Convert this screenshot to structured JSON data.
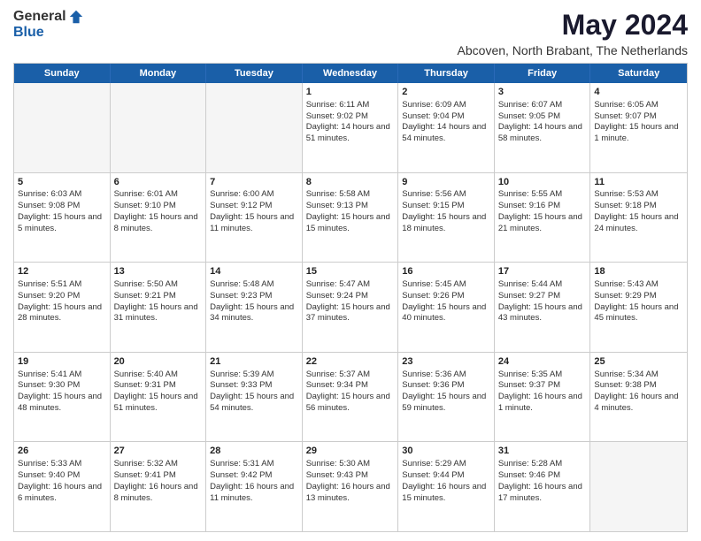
{
  "logo": {
    "general": "General",
    "blue": "Blue"
  },
  "title": "May 2024",
  "location": "Abcoven, North Brabant, The Netherlands",
  "header_days": [
    "Sunday",
    "Monday",
    "Tuesday",
    "Wednesday",
    "Thursday",
    "Friday",
    "Saturday"
  ],
  "weeks": [
    [
      {
        "day": "",
        "info": "",
        "empty": true
      },
      {
        "day": "",
        "info": "",
        "empty": true
      },
      {
        "day": "",
        "info": "",
        "empty": true
      },
      {
        "day": "1",
        "sunrise": "Sunrise: 6:11 AM",
        "sunset": "Sunset: 9:02 PM",
        "daylight": "Daylight: 14 hours and 51 minutes."
      },
      {
        "day": "2",
        "sunrise": "Sunrise: 6:09 AM",
        "sunset": "Sunset: 9:04 PM",
        "daylight": "Daylight: 14 hours and 54 minutes."
      },
      {
        "day": "3",
        "sunrise": "Sunrise: 6:07 AM",
        "sunset": "Sunset: 9:05 PM",
        "daylight": "Daylight: 14 hours and 58 minutes."
      },
      {
        "day": "4",
        "sunrise": "Sunrise: 6:05 AM",
        "sunset": "Sunset: 9:07 PM",
        "daylight": "Daylight: 15 hours and 1 minute."
      }
    ],
    [
      {
        "day": "5",
        "sunrise": "Sunrise: 6:03 AM",
        "sunset": "Sunset: 9:08 PM",
        "daylight": "Daylight: 15 hours and 5 minutes."
      },
      {
        "day": "6",
        "sunrise": "Sunrise: 6:01 AM",
        "sunset": "Sunset: 9:10 PM",
        "daylight": "Daylight: 15 hours and 8 minutes."
      },
      {
        "day": "7",
        "sunrise": "Sunrise: 6:00 AM",
        "sunset": "Sunset: 9:12 PM",
        "daylight": "Daylight: 15 hours and 11 minutes."
      },
      {
        "day": "8",
        "sunrise": "Sunrise: 5:58 AM",
        "sunset": "Sunset: 9:13 PM",
        "daylight": "Daylight: 15 hours and 15 minutes."
      },
      {
        "day": "9",
        "sunrise": "Sunrise: 5:56 AM",
        "sunset": "Sunset: 9:15 PM",
        "daylight": "Daylight: 15 hours and 18 minutes."
      },
      {
        "day": "10",
        "sunrise": "Sunrise: 5:55 AM",
        "sunset": "Sunset: 9:16 PM",
        "daylight": "Daylight: 15 hours and 21 minutes."
      },
      {
        "day": "11",
        "sunrise": "Sunrise: 5:53 AM",
        "sunset": "Sunset: 9:18 PM",
        "daylight": "Daylight: 15 hours and 24 minutes."
      }
    ],
    [
      {
        "day": "12",
        "sunrise": "Sunrise: 5:51 AM",
        "sunset": "Sunset: 9:20 PM",
        "daylight": "Daylight: 15 hours and 28 minutes."
      },
      {
        "day": "13",
        "sunrise": "Sunrise: 5:50 AM",
        "sunset": "Sunset: 9:21 PM",
        "daylight": "Daylight: 15 hours and 31 minutes."
      },
      {
        "day": "14",
        "sunrise": "Sunrise: 5:48 AM",
        "sunset": "Sunset: 9:23 PM",
        "daylight": "Daylight: 15 hours and 34 minutes."
      },
      {
        "day": "15",
        "sunrise": "Sunrise: 5:47 AM",
        "sunset": "Sunset: 9:24 PM",
        "daylight": "Daylight: 15 hours and 37 minutes."
      },
      {
        "day": "16",
        "sunrise": "Sunrise: 5:45 AM",
        "sunset": "Sunset: 9:26 PM",
        "daylight": "Daylight: 15 hours and 40 minutes."
      },
      {
        "day": "17",
        "sunrise": "Sunrise: 5:44 AM",
        "sunset": "Sunset: 9:27 PM",
        "daylight": "Daylight: 15 hours and 43 minutes."
      },
      {
        "day": "18",
        "sunrise": "Sunrise: 5:43 AM",
        "sunset": "Sunset: 9:29 PM",
        "daylight": "Daylight: 15 hours and 45 minutes."
      }
    ],
    [
      {
        "day": "19",
        "sunrise": "Sunrise: 5:41 AM",
        "sunset": "Sunset: 9:30 PM",
        "daylight": "Daylight: 15 hours and 48 minutes."
      },
      {
        "day": "20",
        "sunrise": "Sunrise: 5:40 AM",
        "sunset": "Sunset: 9:31 PM",
        "daylight": "Daylight: 15 hours and 51 minutes."
      },
      {
        "day": "21",
        "sunrise": "Sunrise: 5:39 AM",
        "sunset": "Sunset: 9:33 PM",
        "daylight": "Daylight: 15 hours and 54 minutes."
      },
      {
        "day": "22",
        "sunrise": "Sunrise: 5:37 AM",
        "sunset": "Sunset: 9:34 PM",
        "daylight": "Daylight: 15 hours and 56 minutes."
      },
      {
        "day": "23",
        "sunrise": "Sunrise: 5:36 AM",
        "sunset": "Sunset: 9:36 PM",
        "daylight": "Daylight: 15 hours and 59 minutes."
      },
      {
        "day": "24",
        "sunrise": "Sunrise: 5:35 AM",
        "sunset": "Sunset: 9:37 PM",
        "daylight": "Daylight: 16 hours and 1 minute."
      },
      {
        "day": "25",
        "sunrise": "Sunrise: 5:34 AM",
        "sunset": "Sunset: 9:38 PM",
        "daylight": "Daylight: 16 hours and 4 minutes."
      }
    ],
    [
      {
        "day": "26",
        "sunrise": "Sunrise: 5:33 AM",
        "sunset": "Sunset: 9:40 PM",
        "daylight": "Daylight: 16 hours and 6 minutes."
      },
      {
        "day": "27",
        "sunrise": "Sunrise: 5:32 AM",
        "sunset": "Sunset: 9:41 PM",
        "daylight": "Daylight: 16 hours and 8 minutes."
      },
      {
        "day": "28",
        "sunrise": "Sunrise: 5:31 AM",
        "sunset": "Sunset: 9:42 PM",
        "daylight": "Daylight: 16 hours and 11 minutes."
      },
      {
        "day": "29",
        "sunrise": "Sunrise: 5:30 AM",
        "sunset": "Sunset: 9:43 PM",
        "daylight": "Daylight: 16 hours and 13 minutes."
      },
      {
        "day": "30",
        "sunrise": "Sunrise: 5:29 AM",
        "sunset": "Sunset: 9:44 PM",
        "daylight": "Daylight: 16 hours and 15 minutes."
      },
      {
        "day": "31",
        "sunrise": "Sunrise: 5:28 AM",
        "sunset": "Sunset: 9:46 PM",
        "daylight": "Daylight: 16 hours and 17 minutes."
      },
      {
        "day": "",
        "info": "",
        "empty": true
      }
    ]
  ]
}
